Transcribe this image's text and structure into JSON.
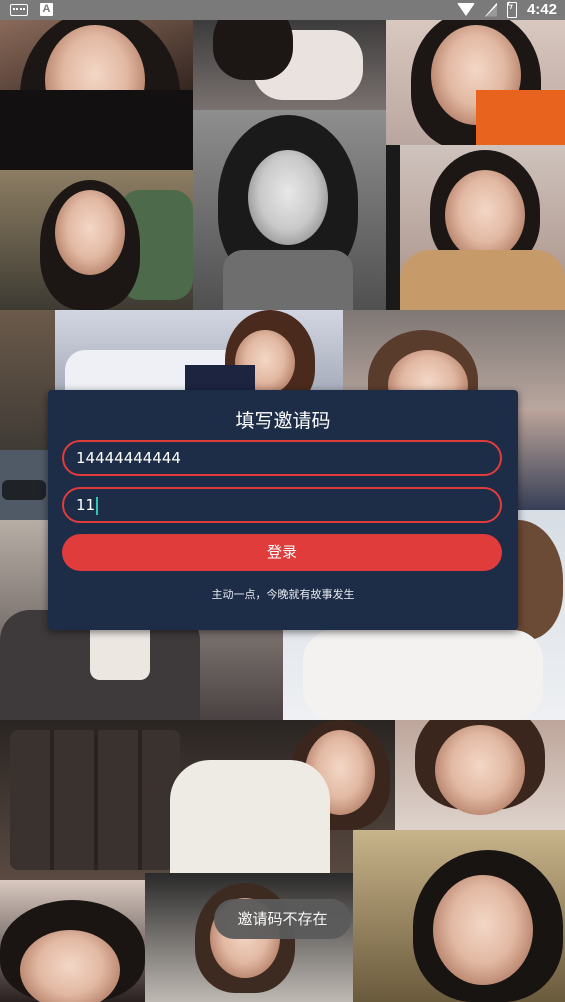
{
  "status_bar": {
    "time": "4:42",
    "icons": [
      "keyboard-icon",
      "a-icon",
      "wifi-icon",
      "no-signal-icon",
      "battery-charging-icon"
    ]
  },
  "background": {
    "description_icon": "photo-collage",
    "colors": {
      "dark": "#1c1715",
      "skin": "#e2b9a3"
    }
  },
  "dialog": {
    "title": "填写邀请码",
    "phone_value": "14444444444",
    "invite_code_value": "11",
    "login_label": "登录",
    "tagline": "主动一点，今晚就有故事发生",
    "colors": {
      "card": "#1e2d47",
      "accent": "#e03c3c"
    }
  },
  "toast": {
    "message": "邀请码不存在"
  }
}
